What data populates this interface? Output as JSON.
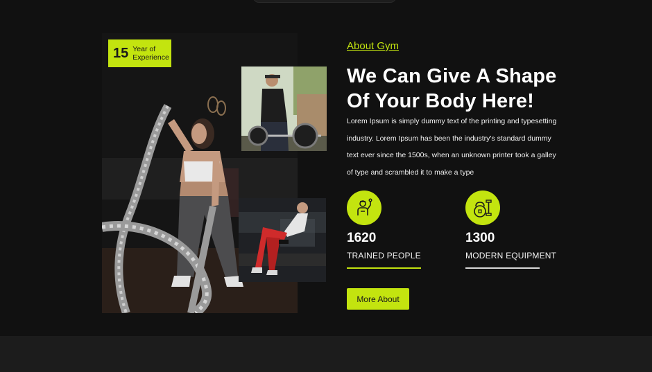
{
  "experience_badge": {
    "number": "15",
    "line1": "Year of",
    "line2": "Experience"
  },
  "about": {
    "link_text": "About Gym",
    "headline_line1": "We Can Give A Shape",
    "headline_line2": "Of Your Body Here!",
    "paragraph": "Lorem Ipsum is simply dummy text of the printing and typesetting industry. Lorem Ipsum has been the industry's standard dummy text ever since the 1500s, when an unknown printer took a galley of type and scrambled it to make a type"
  },
  "stats": [
    {
      "value": "1620",
      "label": "TRAINED PEOPLE",
      "icon": "trainer-icon"
    },
    {
      "value": "1300",
      "label": "MODERN EQUIPMENT",
      "icon": "kettlebell-dumbbell-icon"
    }
  ],
  "cta": {
    "label": "More About"
  },
  "colors": {
    "accent": "#c3e40f",
    "background": "#111111",
    "footer_band": "#1c1c1c"
  }
}
